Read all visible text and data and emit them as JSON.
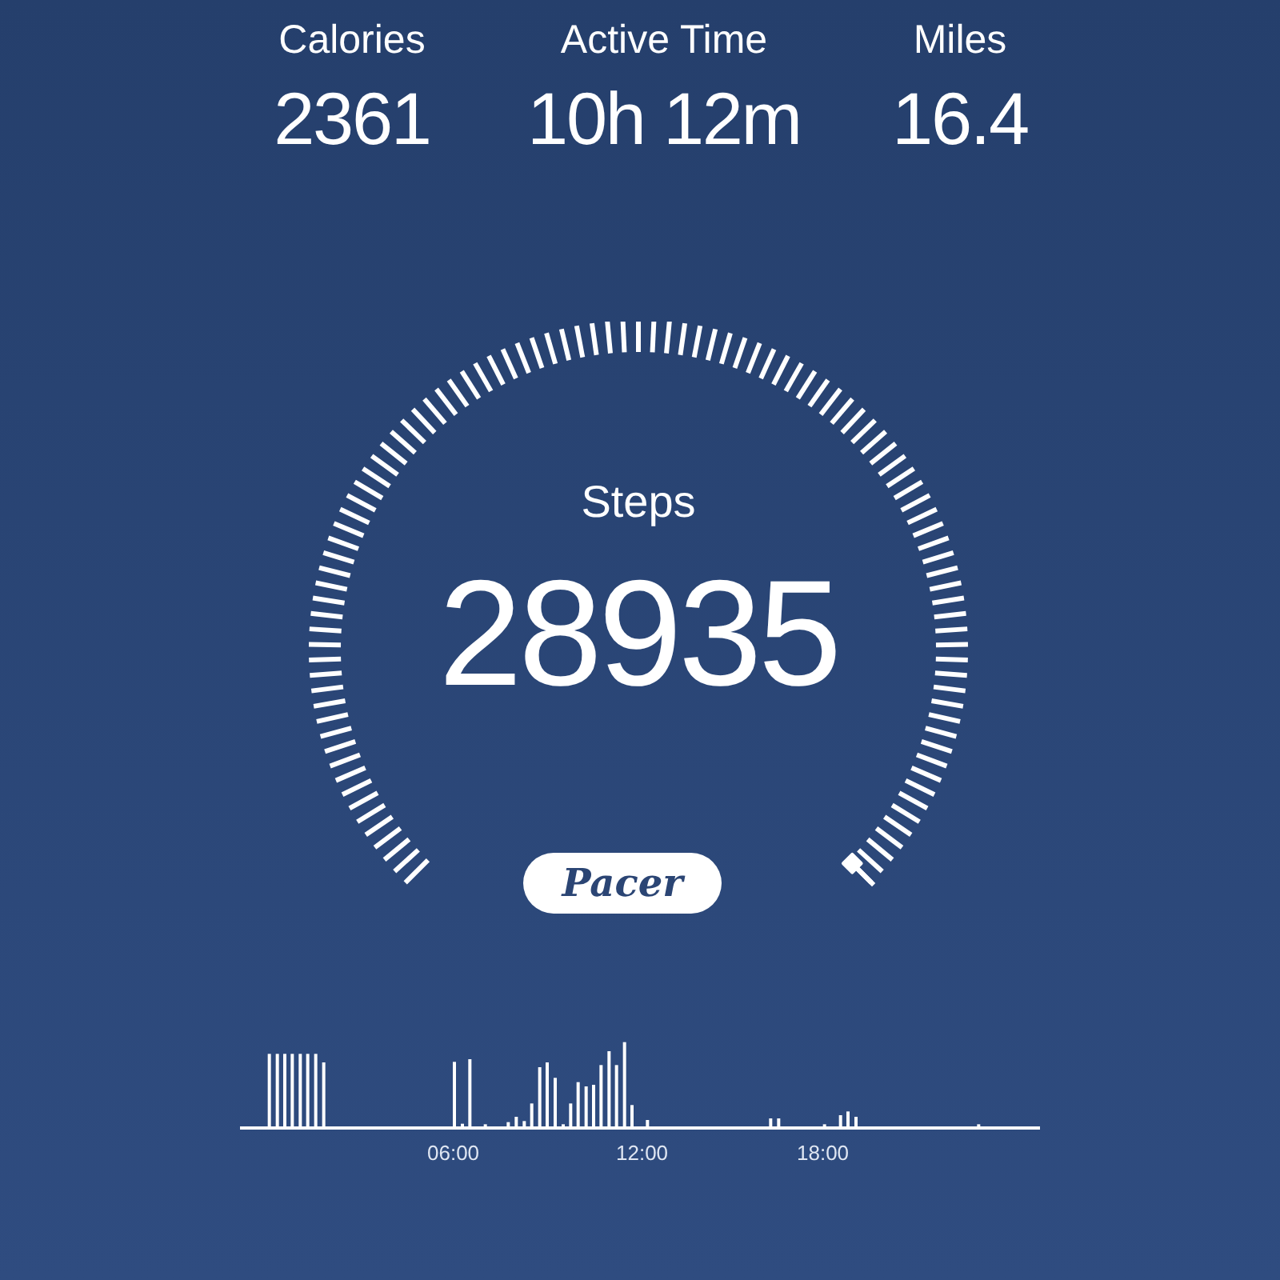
{
  "stats": [
    {
      "label": "Calories",
      "value": "2361"
    },
    {
      "label": "Active Time",
      "value": "10h 12m"
    },
    {
      "label": "Miles",
      "value": "16.4"
    }
  ],
  "gauge": {
    "label": "Steps",
    "value": "28935"
  },
  "logo": "Pacer",
  "activity_chart": {
    "time_labels": [
      "06:00",
      "12:00",
      "18:00"
    ]
  }
}
